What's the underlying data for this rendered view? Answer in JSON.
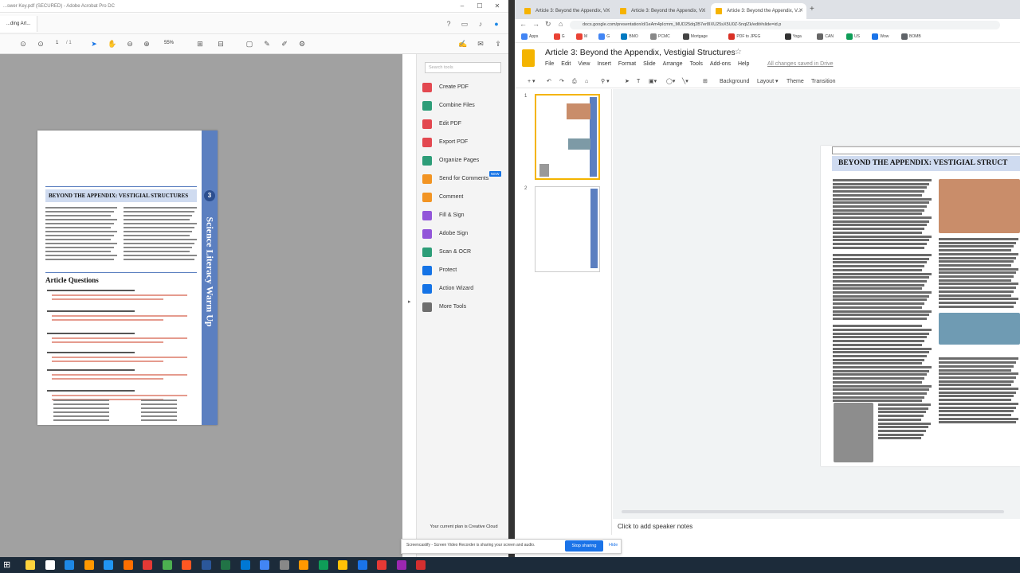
{
  "acrobat": {
    "window_title": "...swer Key.pdf (SECURED) - Adobe Acrobat Pro DC",
    "tab_label": "...ding Art...",
    "page_current": "1",
    "page_total": "/ 1",
    "zoom": "55%",
    "search_placeholder": "Search tools",
    "tools": [
      {
        "label": "Create PDF",
        "color": "#e34850",
        "icon": "create-pdf-icon"
      },
      {
        "label": "Combine Files",
        "color": "#2d9d78",
        "icon": "combine-files-icon"
      },
      {
        "label": "Edit PDF",
        "color": "#e34850",
        "icon": "edit-pdf-icon"
      },
      {
        "label": "Export PDF",
        "color": "#e34850",
        "icon": "export-pdf-icon"
      },
      {
        "label": "Organize Pages",
        "color": "#2d9d78",
        "icon": "organize-pages-icon"
      },
      {
        "label": "Send for Comments",
        "color": "#f29423",
        "icon": "send-for-comments-icon"
      },
      {
        "label": "Comment",
        "color": "#f29423",
        "icon": "comment-icon"
      },
      {
        "label": "Fill & Sign",
        "color": "#9256d9",
        "icon": "fill-sign-icon"
      },
      {
        "label": "Adobe Sign",
        "color": "#9256d9",
        "icon": "adobe-sign-icon"
      },
      {
        "label": "Scan & OCR",
        "color": "#2d9d78",
        "icon": "scan-ocr-icon"
      },
      {
        "label": "Protect",
        "color": "#1473e6",
        "icon": "protect-icon"
      },
      {
        "label": "Action Wizard",
        "color": "#1473e6",
        "icon": "action-wizard-icon"
      },
      {
        "label": "More Tools",
        "color": "#6e6e6e",
        "icon": "more-tools-icon"
      }
    ],
    "new_badge": "NEW",
    "plan_text": "Your current plan is Creative Cloud",
    "page_preview": {
      "banner": "BEYOND THE APPENDIX: VESTIGIAL STRUCTURES",
      "badge": "3",
      "side_text": "Science Literacy Warm Up",
      "article_questions": "Article Questions"
    }
  },
  "chrome": {
    "tabs": [
      {
        "label": "Article 3: Beyond the Appendix, V..."
      },
      {
        "label": "Article 3: Beyond the Appendix, V..."
      },
      {
        "label": "Article 3: Beyond the Appendix, V..."
      }
    ],
    "new_tab": "+",
    "url": "docs.google.com/presentation/d/1eAm4pIcmm_MUD25dq2B7er8IXU25sX5U0Z-5nqlZk/edit#slide=id.p",
    "bookmarks": [
      "Apps",
      "G",
      "M",
      "G",
      "BMO",
      "PCMC",
      "Mortgage",
      "PDF to JPEG",
      "Yoga",
      "CAN",
      "US",
      "Wow",
      "BOMB"
    ]
  },
  "slides": {
    "doc_title": "Article 3: Beyond the Appendix, Vestigial Structures",
    "menu": [
      "File",
      "Edit",
      "View",
      "Insert",
      "Format",
      "Slide",
      "Arrange",
      "Tools",
      "Add-ons",
      "Help"
    ],
    "save_status": "All changes saved in Drive",
    "toolbar": {
      "background": "Background",
      "layout": "Layout",
      "theme": "Theme",
      "transition": "Transition"
    },
    "slide_numbers": [
      "1",
      "2"
    ],
    "slide_banner": "BEYOND THE APPENDIX: VESTIGIAL STRUCT",
    "speaker_notes_placeholder": "Click to add speaker notes"
  },
  "share_bar": {
    "text": "Screencastify - Screen Video Recorder is sharing your screen and audio.",
    "stop_label": "Stop sharing",
    "hide_label": "Hide"
  },
  "taskbar": {
    "start": "⊞",
    "app_colors": [
      "#ffd33d",
      "#ffffff",
      "#1e88e5",
      "#ff9800",
      "#2196f3",
      "#ff6f00",
      "#e53935",
      "#4caf50",
      "#ff5722",
      "#2b579a",
      "#217346",
      "#0078d4",
      "#4285f4",
      "#888888",
      "#ff9800",
      "#0f9d58",
      "#ffc107",
      "#1a73e8",
      "#e53935",
      "#9c27b0",
      "#d32f2f"
    ]
  }
}
